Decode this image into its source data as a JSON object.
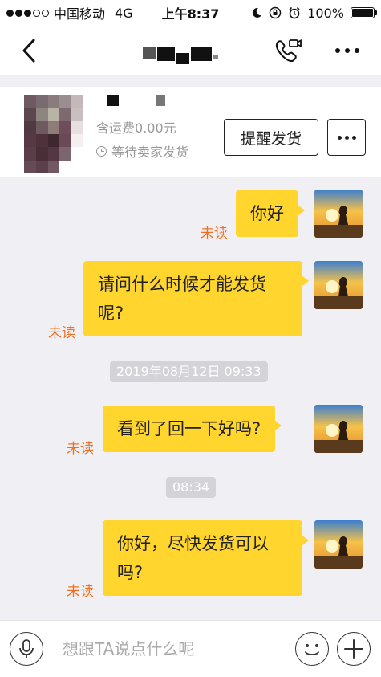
{
  "status_bar": {
    "carrier": "中国移动",
    "network": "4G",
    "time": "上午8:37",
    "battery": "100%"
  },
  "nav": {
    "back_icon": "chevron-left-icon",
    "call_icon": "phone-video-icon",
    "more_icon": "more-dots-icon"
  },
  "product": {
    "shipping": "含运费0.00元",
    "status": "等待卖家发货",
    "remind_label": "提醒发货"
  },
  "messages": [
    {
      "text": "你好",
      "status": "未读"
    },
    {
      "text_line1": "请问什么时候才能发货",
      "text_line2": "呢?",
      "status": "未读"
    },
    {
      "text": "看到了回一下好吗?",
      "status": "未读"
    },
    {
      "text_line1": "你好，尽快发货可以",
      "text_line2": "吗?",
      "status": "未读"
    }
  ],
  "timestamps": [
    "2019年08月12日 09:33",
    "08:34"
  ],
  "input": {
    "placeholder": "想跟TA说点什么呢"
  },
  "colors": {
    "bubble": "#ffd52e",
    "unread": "#f07020",
    "timestamp_bg": "#d3d3d8"
  }
}
